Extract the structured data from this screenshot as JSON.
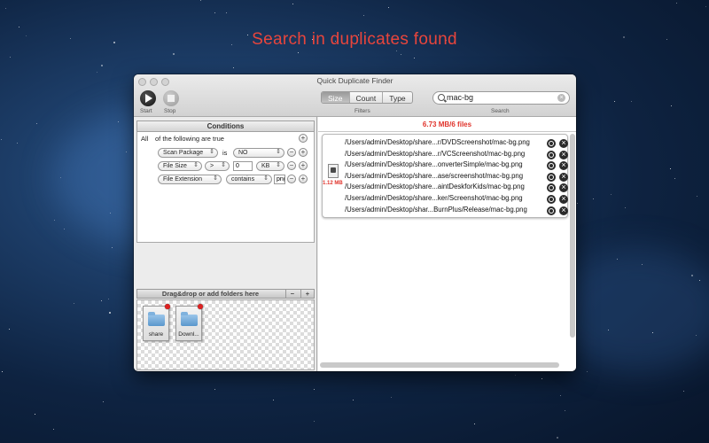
{
  "headline": "Search in duplicates found",
  "window": {
    "title": "Quick Duplicate Finder"
  },
  "toolbar": {
    "start_label": "Start",
    "stop_label": "Stop",
    "filters_label": "Filters",
    "search_label": "Search",
    "tabs": [
      {
        "label": "Size",
        "active": true
      },
      {
        "label": "Count",
        "active": false
      },
      {
        "label": "Type",
        "active": false
      }
    ],
    "search_value": "mac-bg"
  },
  "conditions": {
    "header": "Conditions",
    "all_label": "All",
    "all_suffix": "of the following are true",
    "rows": [
      {
        "field": "Scan Package",
        "operator": "is",
        "value": "NO"
      },
      {
        "field": "File Size",
        "operator": ">",
        "value": "0",
        "unit": "KB"
      },
      {
        "field": "File Extension",
        "operator": "contains",
        "value": "png"
      }
    ]
  },
  "drop_zone": {
    "header": "Drag&drop or add folders here",
    "minus": "−",
    "plus": "+",
    "folders": [
      "share",
      "Downl..."
    ]
  },
  "results": {
    "summary": "6.73 MB/6 files",
    "group_size": "1.12 MB",
    "files": [
      "/Users/admin/Desktop/share...r/DVDScreenshot/mac-bg.png",
      "/Users/admin/Desktop/share...r/VCScreenshot/mac-bg.png",
      "/Users/admin/Desktop/share...onverterSimple/mac-bg.png",
      "/Users/admin/Desktop/share...ase/screenshot/mac-bg.png",
      "/Users/admin/Desktop/share...aintDeskforKids/mac-bg.png",
      "/Users/admin/Desktop/share...ker/Screenshot/mac-bg.png",
      "/Users/admin/Desktop/shar...BurnPlus/Release/mac-bg.png"
    ]
  },
  "colors": {
    "accent_red": "#e0332b",
    "headline_red": "#e8453c"
  }
}
